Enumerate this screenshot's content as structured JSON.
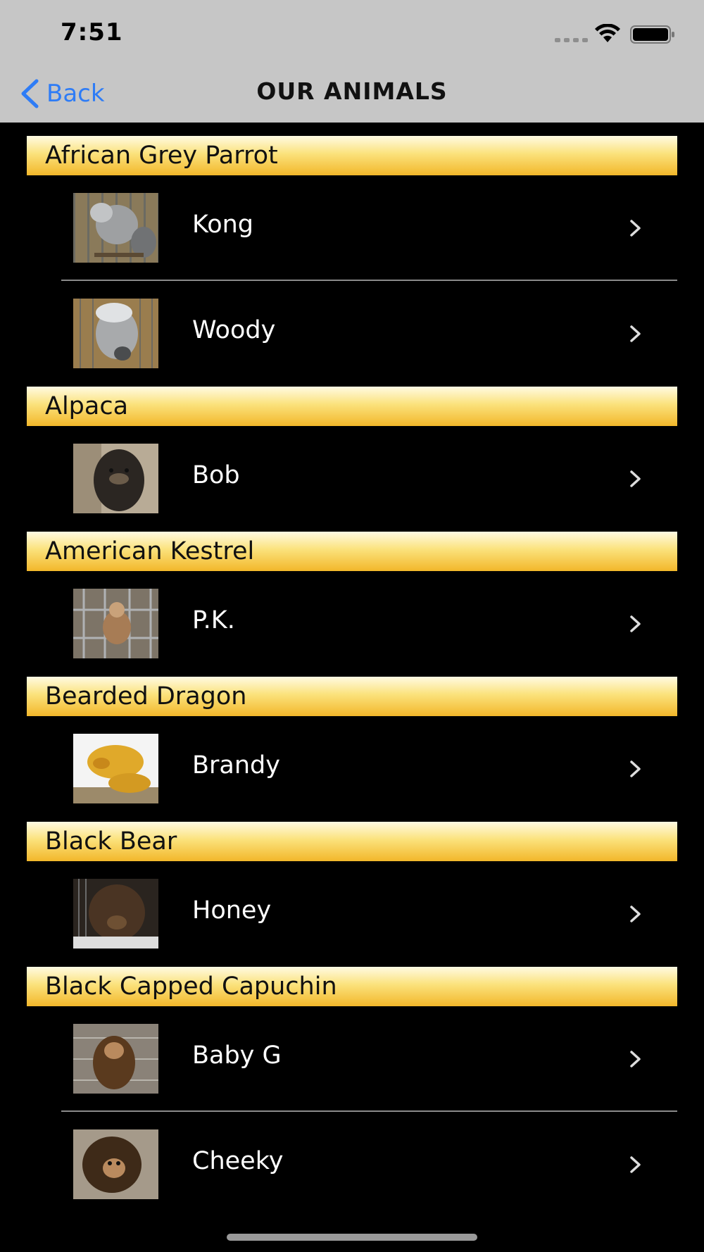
{
  "status_bar": {
    "time": "7:51"
  },
  "nav": {
    "back_label": "Back",
    "title": "OUR ANIMALS"
  },
  "colors": {
    "accent": "#2e7cf6",
    "header_gold": "#f2b72a",
    "background": "#000000"
  },
  "sections": [
    {
      "title": "African Grey Parrot",
      "animals": [
        {
          "name": "Kong"
        },
        {
          "name": "Woody"
        }
      ]
    },
    {
      "title": "Alpaca",
      "animals": [
        {
          "name": "Bob"
        }
      ]
    },
    {
      "title": "American Kestrel",
      "animals": [
        {
          "name": "P.K."
        }
      ]
    },
    {
      "title": "Bearded Dragon",
      "animals": [
        {
          "name": "Brandy"
        }
      ]
    },
    {
      "title": "Black Bear",
      "animals": [
        {
          "name": "Honey"
        }
      ]
    },
    {
      "title": "Black Capped Capuchin",
      "animals": [
        {
          "name": "Baby G"
        },
        {
          "name": "Cheeky"
        }
      ]
    }
  ]
}
